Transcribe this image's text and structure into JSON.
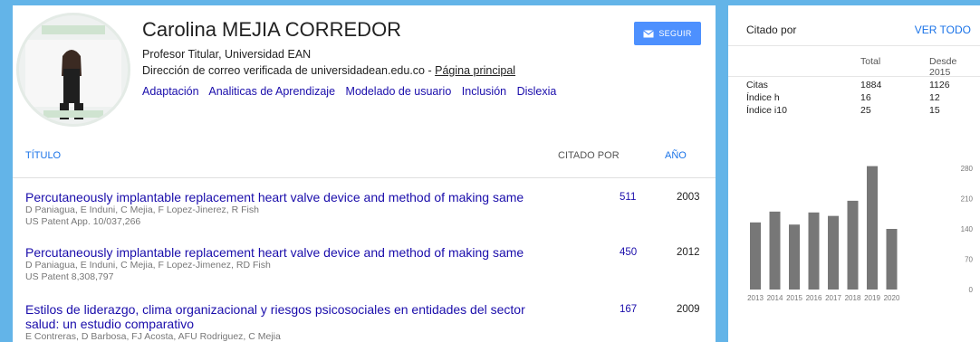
{
  "profile": {
    "name": "Carolina MEJIA CORREDOR",
    "affiliation": "Profesor Titular, Universidad EAN",
    "email_text": "Dirección de correo verificada de universidadean.edu.co - ",
    "homepage_label": "Página principal",
    "follow_label": "SEGUIR",
    "interests": [
      "Adaptación",
      "Analiticas de Aprendizaje",
      "Modelado de usuario",
      "Inclusión",
      "Dislexia"
    ]
  },
  "table": {
    "col_title": "TÍTULO",
    "col_cited": "CITADO POR",
    "col_year": "AÑO",
    "rows": [
      {
        "title": "Percutaneously implantable replacement heart valve device and method of making same",
        "authors": "D Paniagua, E Induni, C Mejia, F Lopez-Jinerez, R Fish",
        "venue": "US Patent App. 10/037,266",
        "cited": "511",
        "year": "2003"
      },
      {
        "title": "Percutaneously implantable replacement heart valve device and method of making same",
        "authors": "D Paniagua, E Induni, C Mejia, F Lopez-Jimenez, RD Fish",
        "venue": "US Patent 8,308,797",
        "cited": "450",
        "year": "2012"
      },
      {
        "title": "Estilos de liderazgo, clima organizacional y riesgos psicosociales en entidades del sector salud: un estudio comparativo",
        "authors": "E Contreras, D Barbosa, FJ Acosta, AFU Rodriguez, C Mejia",
        "venue": "",
        "cited": "167",
        "year": "2009"
      }
    ]
  },
  "cited_by": {
    "title": "Citado por",
    "view_all": "VER TODO",
    "headers": [
      "",
      "Total",
      "Desde 2015"
    ],
    "rows": [
      {
        "label": "Citas",
        "total": "1884",
        "since": "1126"
      },
      {
        "label": "Índice h",
        "total": "16",
        "since": "12"
      },
      {
        "label": "Índice i10",
        "total": "25",
        "since": "15"
      }
    ]
  },
  "chart_data": {
    "type": "bar",
    "categories": [
      "2013",
      "2014",
      "2015",
      "2016",
      "2017",
      "2018",
      "2019",
      "2020"
    ],
    "values": [
      155,
      180,
      150,
      178,
      170,
      205,
      285,
      140
    ],
    "ylim": [
      0,
      280
    ],
    "yticks": [
      "280",
      "210",
      "140",
      "70",
      "0"
    ],
    "bar_color": "#777777"
  },
  "colors": {
    "background": "#63b4e8",
    "link": "#1a0dab",
    "accent": "#4d90fe"
  }
}
